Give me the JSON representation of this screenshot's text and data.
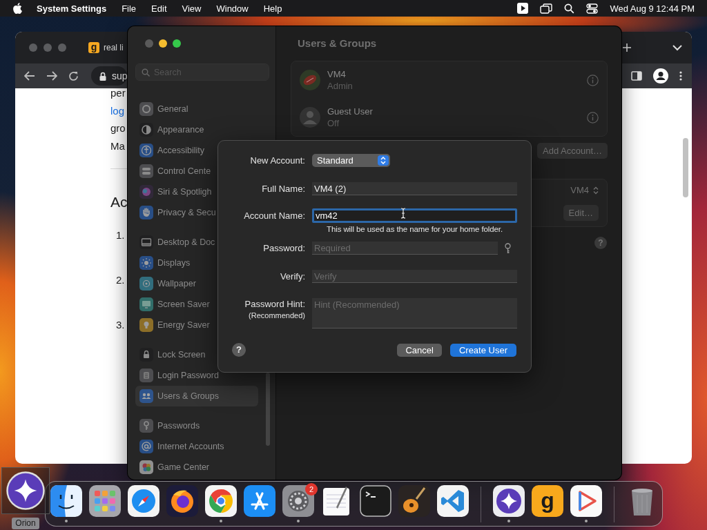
{
  "menu_bar": {
    "app_name": "System Settings",
    "menus": [
      "File",
      "Edit",
      "View",
      "Window",
      "Help"
    ],
    "clock": "Wed Aug 9  12:44 PM"
  },
  "browser": {
    "favicon_letter": "g",
    "tab_title": "real li",
    "address": "sup",
    "lines": [
      {
        "kind": "text",
        "text": "per"
      },
      {
        "kind": "link",
        "text": "log"
      },
      {
        "kind": "text",
        "text": "gro"
      },
      {
        "kind": "text",
        "text": "Ma"
      }
    ],
    "heading": "Ac",
    "steps": [
      "1.",
      "2.",
      "3."
    ]
  },
  "settings": {
    "search_placeholder": "Search",
    "sidebar_groups": [
      {
        "items": [
          {
            "label": "General",
            "selected": false
          },
          {
            "label": "Appearance",
            "selected": false
          },
          {
            "label": "Accessibility",
            "selected": false
          },
          {
            "label": "Control Cente",
            "selected": false
          },
          {
            "label": "Siri & Spotligh",
            "selected": false
          },
          {
            "label": "Privacy & Secu",
            "selected": false
          }
        ]
      },
      {
        "items": [
          {
            "label": "Desktop & Doc",
            "selected": false
          },
          {
            "label": "Displays",
            "selected": false
          },
          {
            "label": "Wallpaper",
            "selected": false
          },
          {
            "label": "Screen Saver",
            "selected": false
          },
          {
            "label": "Energy Saver",
            "selected": false
          }
        ]
      },
      {
        "items": [
          {
            "label": "Lock Screen",
            "selected": false
          },
          {
            "label": "Login Password",
            "selected": false
          },
          {
            "label": "Users & Groups",
            "selected": true
          }
        ]
      },
      {
        "items": [
          {
            "label": "Passwords",
            "selected": false
          },
          {
            "label": "Internet Accounts",
            "selected": false
          },
          {
            "label": "Game Center",
            "selected": false
          }
        ]
      }
    ],
    "title": "Users & Groups",
    "users": [
      {
        "name": "VM4",
        "role": "Admin",
        "kind": "photo"
      },
      {
        "name": "Guest User",
        "role": "Off",
        "kind": "guest"
      }
    ],
    "add_account_button": "Add Account…",
    "auto_login_value": "VM4",
    "edit_button": "Edit…",
    "help_button": "?"
  },
  "dialog": {
    "new_account_label": "New Account:",
    "account_type": "Standard",
    "full_name_label": "Full Name:",
    "full_name": "VM4 (2)",
    "account_name_label": "Account Name:",
    "account_name": "vm42",
    "account_name_note": "This will be used as the name for your home folder.",
    "password_label": "Password:",
    "password_placeholder": "Required",
    "verify_label": "Verify:",
    "verify_placeholder": "Verify",
    "hint_label": "Password Hint:",
    "hint_sublabel": "(Recommended)",
    "hint_placeholder": "Hint (Recommended)",
    "help_button": "?",
    "cancel_button": "Cancel",
    "create_button": "Create User"
  },
  "dock": {
    "hover_label": "Orion",
    "items": [
      {
        "kind": "app",
        "running": true
      },
      {
        "kind": "app",
        "running": false
      },
      {
        "kind": "app",
        "running": false
      },
      {
        "kind": "app",
        "running": false
      },
      {
        "kind": "app",
        "running": true
      },
      {
        "kind": "app",
        "running": false
      },
      {
        "kind": "app",
        "running": true,
        "badge": "2"
      },
      {
        "kind": "app",
        "running": false
      },
      {
        "kind": "app",
        "running": false
      },
      {
        "kind": "app",
        "running": false
      },
      {
        "kind": "app",
        "running": false
      },
      {
        "kind": "separator"
      },
      {
        "kind": "app",
        "running": true
      },
      {
        "kind": "app",
        "running": false,
        "letter": "g"
      },
      {
        "kind": "app",
        "running": true
      },
      {
        "kind": "separator"
      },
      {
        "kind": "trash",
        "running": false
      }
    ]
  }
}
